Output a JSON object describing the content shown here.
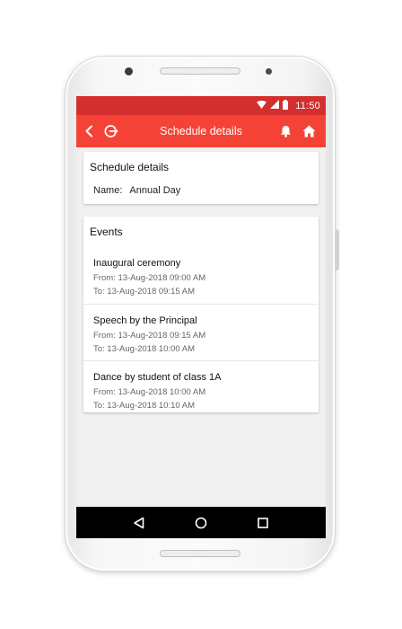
{
  "status_bar": {
    "time": "11:50",
    "icons": [
      "wifi-icon",
      "signal-icon",
      "battery-icon"
    ]
  },
  "app_bar": {
    "title": "Schedule details",
    "icons": [
      "back-arrow-icon",
      "logout-icon",
      "bell-icon",
      "home-icon"
    ]
  },
  "schedule_card": {
    "title": "Schedule details",
    "name_label": "Name:",
    "name_value": "Annual Day"
  },
  "events_card": {
    "title": "Events",
    "items": [
      {
        "title": "Inaugural ceremony",
        "from": "From: 13-Aug-2018 09:00 AM",
        "to": "To: 13-Aug-2018 09:15 AM"
      },
      {
        "title": "Speech by the Principal",
        "from": "From: 13-Aug-2018 09:15 AM",
        "to": "To: 13-Aug-2018 10:00 AM"
      },
      {
        "title": "Dance by student of class 1A",
        "from": "From: 13-Aug-2018 10:00 AM",
        "to": "To: 13-Aug-2018 10:10 AM"
      }
    ]
  },
  "nav_bar": {
    "icons": [
      "nav-back-icon",
      "nav-home-icon",
      "nav-recents-icon"
    ]
  },
  "colors": {
    "status_bar": "#d32f2f",
    "app_bar": "#f44336",
    "background": "#f0f0f0",
    "nav_bar": "#000000"
  }
}
